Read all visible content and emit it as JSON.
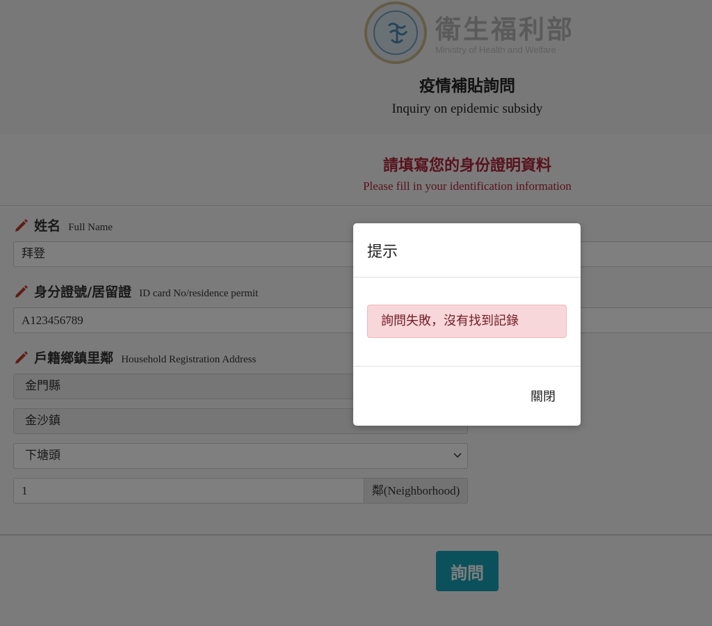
{
  "header": {
    "org_name_cn": "衛生福利部",
    "org_name_en": "Ministry of Health and Welfare",
    "title_cn": "疫情補貼詢問",
    "title_en": "Inquiry on epidemic subsidy"
  },
  "form": {
    "notice_cn": "請填寫您的身份證明資料",
    "notice_en": "Please fill in your identification information",
    "name_label_cn": "姓名",
    "name_label_en": "Full Name",
    "name_value": "拜登",
    "id_label_cn": "身分證號/居留證",
    "id_label_en": "ID card No/residence permit",
    "id_value": "A123456789",
    "address_label_cn": "戶籍鄉鎮里鄰",
    "address_label_en": "Household Registration Address",
    "county_value": "金門縣",
    "township_value": "金沙鎮",
    "village_value": "下塘頭",
    "neighborhood_value": "1",
    "neighborhood_addon": "鄰(Neighborhood)",
    "submit_label": "詢問"
  },
  "modal": {
    "title": "提示",
    "message": "詢問失敗，沒有找到記錄",
    "close_label": "關閉"
  },
  "colors": {
    "accent": "#17a2b8",
    "notice": "#b0243a",
    "alert_bg": "#f8d7da",
    "alert_text": "#721c24",
    "pencil": "#c0392b"
  },
  "icons": {
    "label_icon": "pencil-icon",
    "select_icon": "chevron-down-icon",
    "logo": "ministry-seal-logo"
  }
}
